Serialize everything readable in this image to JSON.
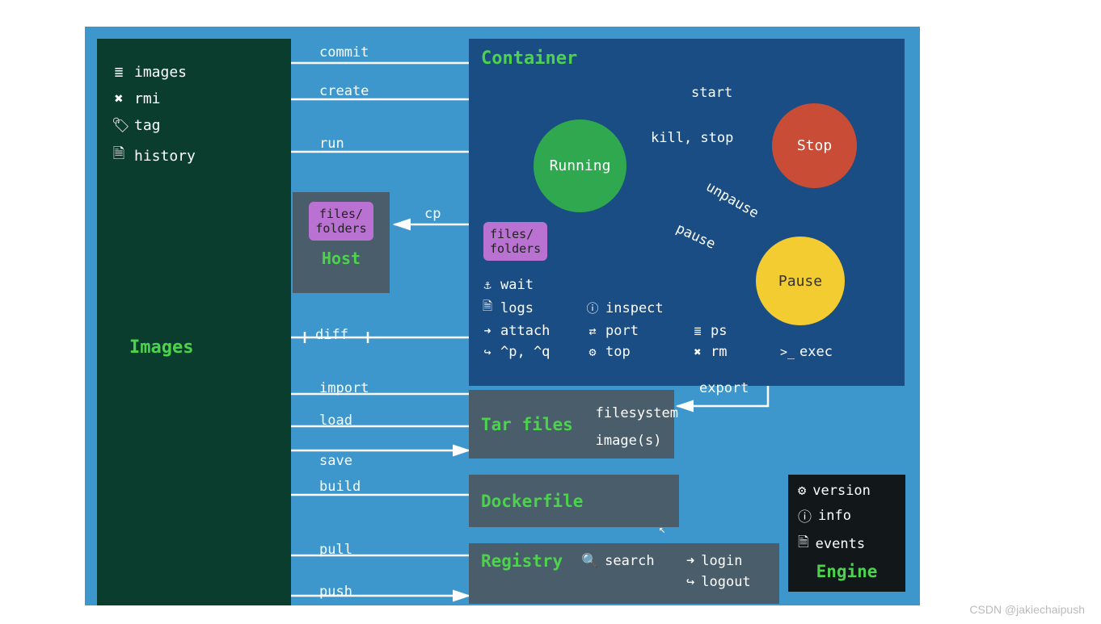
{
  "images_panel": {
    "title": "Images",
    "items": [
      {
        "icon": "≣",
        "label": "images"
      },
      {
        "icon": "✖",
        "label": "rmi"
      },
      {
        "icon": "🏷",
        "label": "tag"
      },
      {
        "icon": "🗎",
        "label": "history"
      }
    ]
  },
  "container_panel": {
    "title": "Container",
    "states": {
      "running": "Running",
      "stop": "Stop",
      "pause": "Pause"
    },
    "files_folders": "files/\nfolders",
    "commands": {
      "wait": "wait",
      "logs": "logs",
      "attach": "attach",
      "pq": "^p, ^q",
      "inspect": "inspect",
      "port": "port",
      "top": "top",
      "ps": "ps",
      "rm": "rm",
      "exec": "exec"
    }
  },
  "host_panel": {
    "title": "Host",
    "files_folders": "files/\nfolders"
  },
  "tar_panel": {
    "title": "Tar files",
    "filesystem": "filesystem",
    "images": "image(s)"
  },
  "dockerfile_panel": {
    "title": "Dockerfile"
  },
  "registry_panel": {
    "title": "Registry",
    "commands": {
      "search": "search",
      "login": "login",
      "logout": "logout"
    }
  },
  "engine_panel": {
    "title": "Engine",
    "items": [
      {
        "icon": "⚙",
        "label": "version"
      },
      {
        "icon": "ⓘ",
        "label": "info"
      },
      {
        "icon": "🗎",
        "label": "events"
      }
    ]
  },
  "arrows": {
    "commit": "commit",
    "create": "create",
    "run": "run",
    "cp": "cp",
    "diff": "diff",
    "import": "import",
    "load": "load",
    "save": "save",
    "build": "build",
    "pull": "pull",
    "push": "push",
    "export": "export",
    "start": "start",
    "kill_stop": "kill, stop",
    "pause": "pause",
    "unpause": "unpause"
  },
  "watermark": "CSDN @jakiechaipush"
}
